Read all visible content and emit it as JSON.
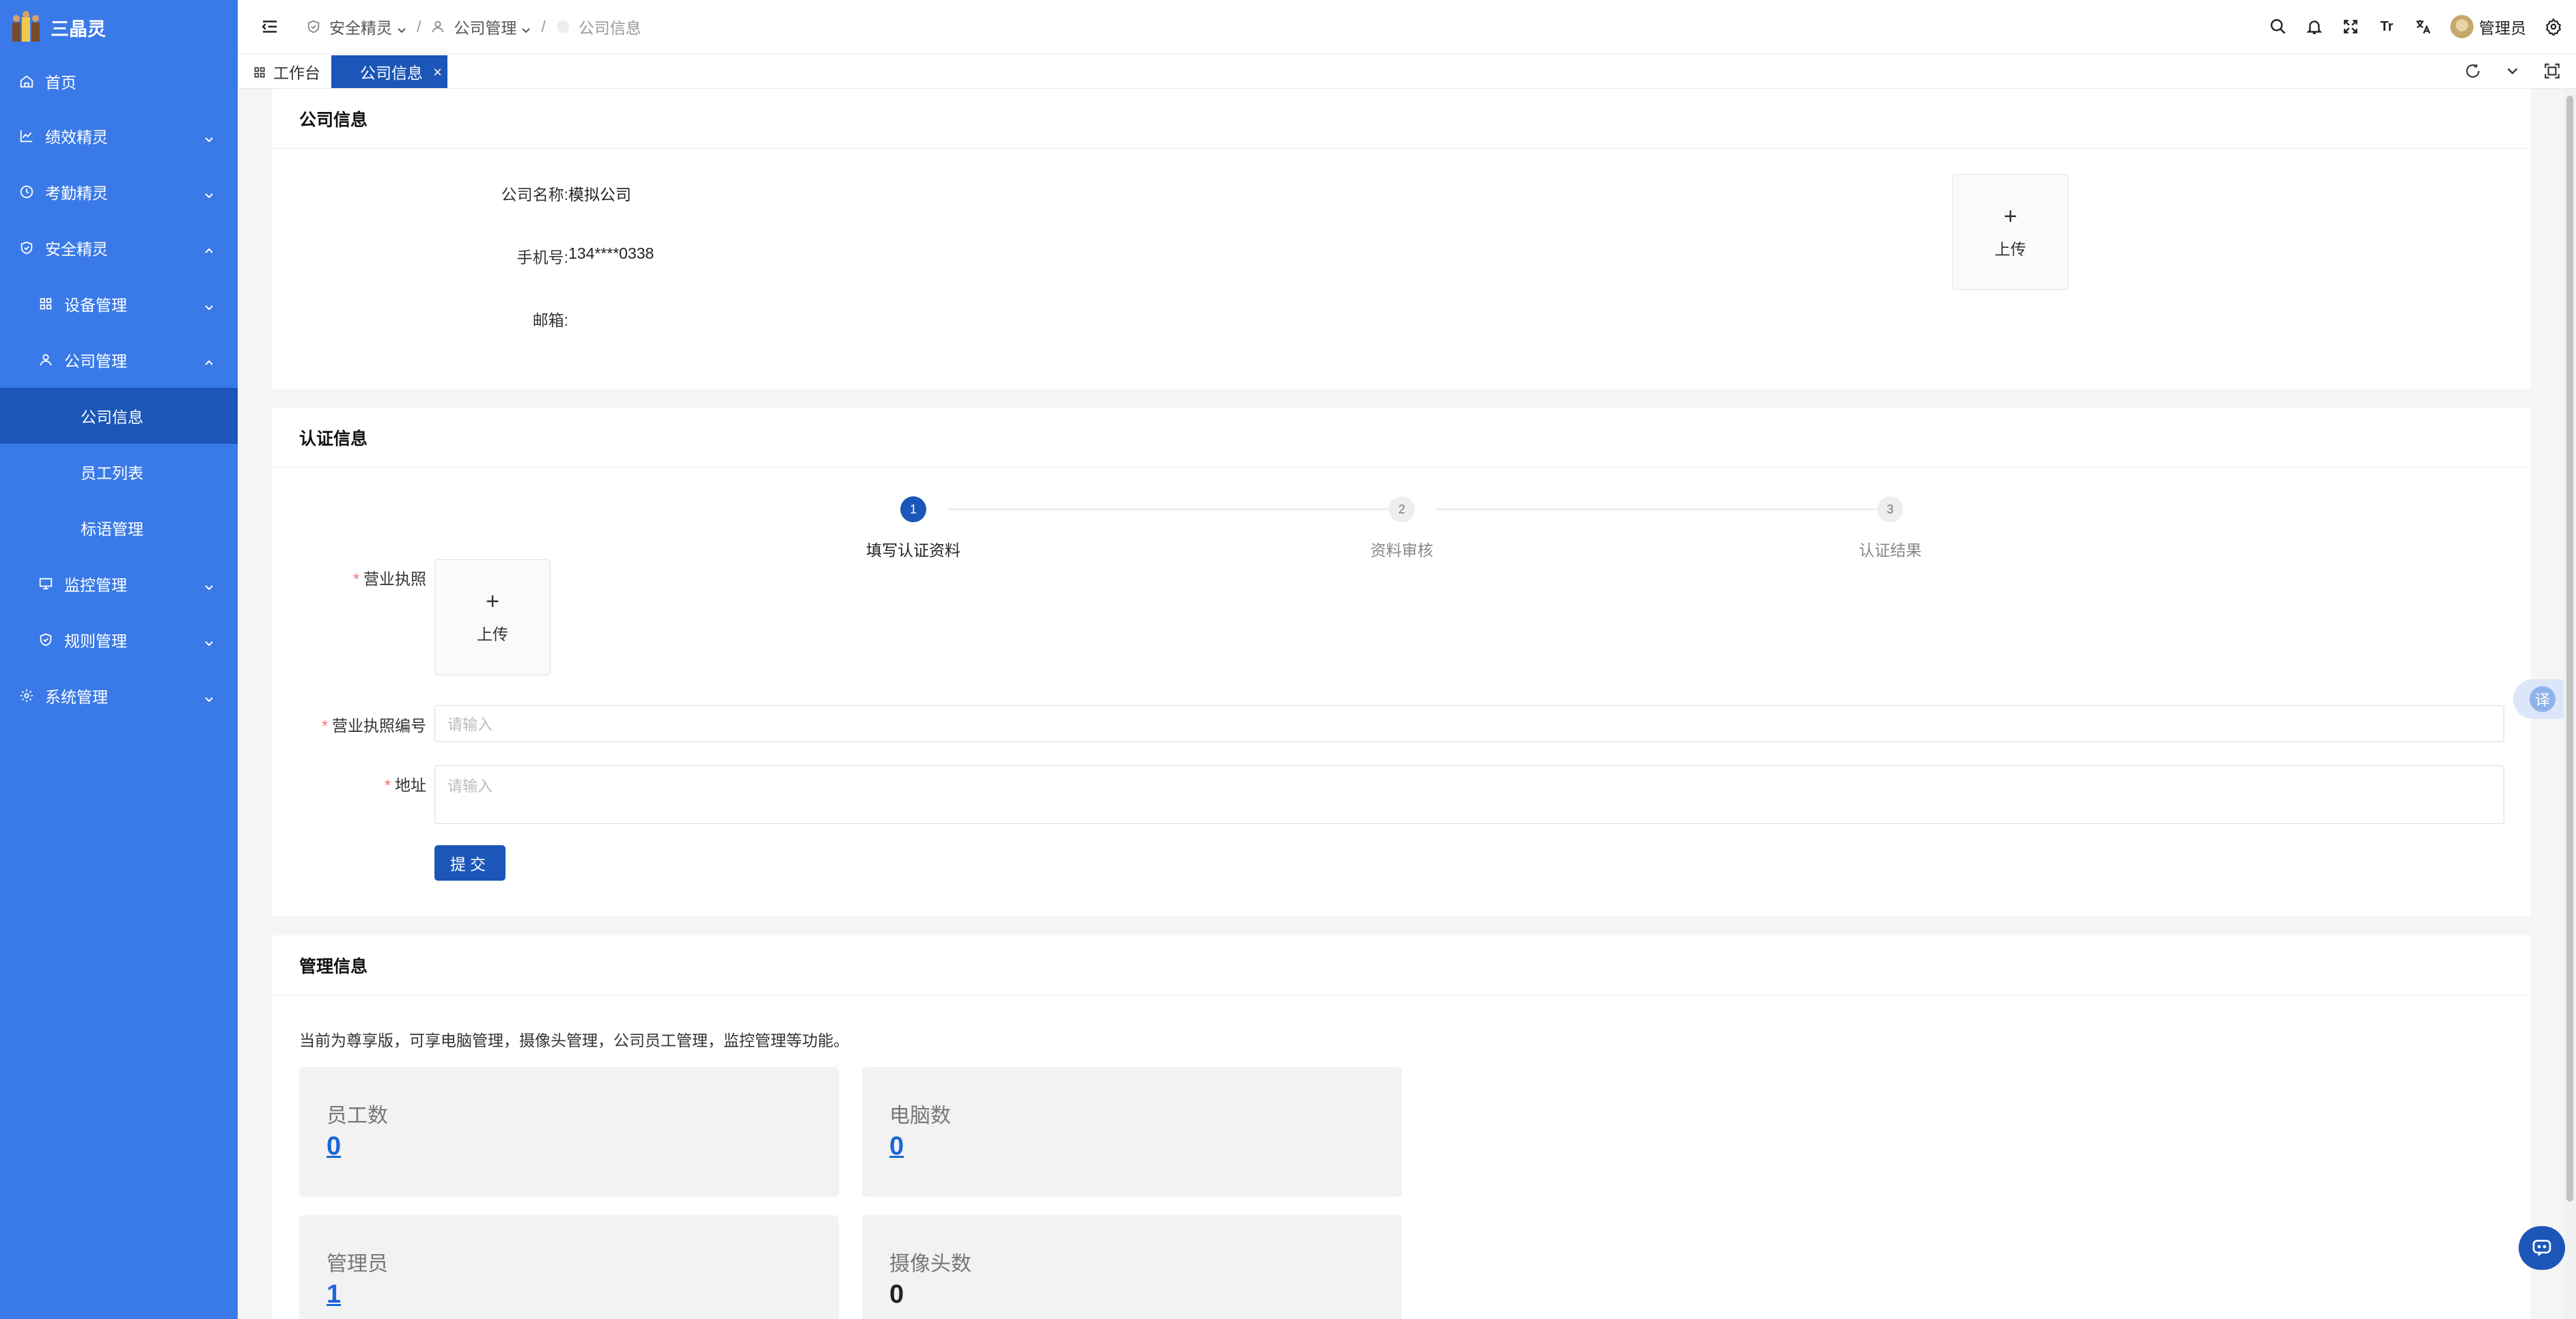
{
  "sidebar": {
    "brand": "三晶灵",
    "items": [
      {
        "label": "首页"
      },
      {
        "label": "绩效精灵"
      },
      {
        "label": "考勤精灵"
      },
      {
        "label": "安全精灵"
      },
      {
        "label": "设备管理"
      },
      {
        "label": "公司管理"
      },
      {
        "label": "公司信息"
      },
      {
        "label": "员工列表"
      },
      {
        "label": "标语管理"
      },
      {
        "label": "监控管理"
      },
      {
        "label": "规则管理"
      },
      {
        "label": "系统管理"
      }
    ]
  },
  "header": {
    "breadcrumb": [
      "安全精灵",
      "公司管理",
      "公司信息"
    ],
    "separator": "/",
    "font_icon_text": "Tr",
    "admin_name": "管理员"
  },
  "tabs": {
    "workbench": "工作台",
    "active": "公司信息",
    "close": "×"
  },
  "company": {
    "title": "公司信息",
    "name_label": "公司名称:",
    "name_value": "模拟公司",
    "phone_label": "手机号:",
    "phone_value": "134****0338",
    "email_label": "邮箱:",
    "email_value": "",
    "upload_plus": "+",
    "upload_label": "上传"
  },
  "cert": {
    "title": "认证信息",
    "steps": [
      {
        "num": "1",
        "label": "填写认证资料"
      },
      {
        "num": "2",
        "label": "资料审核"
      },
      {
        "num": "3",
        "label": "认证结果"
      }
    ],
    "required_mark": "*",
    "license_label": "营业执照",
    "upload_plus": "+",
    "upload_label": "上传",
    "license_no_label": "营业执照编号",
    "license_no_placeholder": "请输入",
    "address_label": "地址",
    "address_placeholder": "请输入",
    "submit_label": "提交"
  },
  "manage": {
    "title": "管理信息",
    "description": "当前为尊享版，可享电脑管理，摄像头管理，公司员工管理，监控管理等功能。",
    "stats": [
      {
        "label": "员工数",
        "value": "0"
      },
      {
        "label": "电脑数",
        "value": "0"
      },
      {
        "label": "管理员",
        "value": "1"
      },
      {
        "label": "摄像头数",
        "value": "0"
      }
    ]
  },
  "floating": {
    "translate": "译"
  },
  "colors": {
    "sidebar": "#3a7ae8",
    "active": "#1b56b8",
    "link": "#1b66d8",
    "required": "#f56c6c"
  }
}
